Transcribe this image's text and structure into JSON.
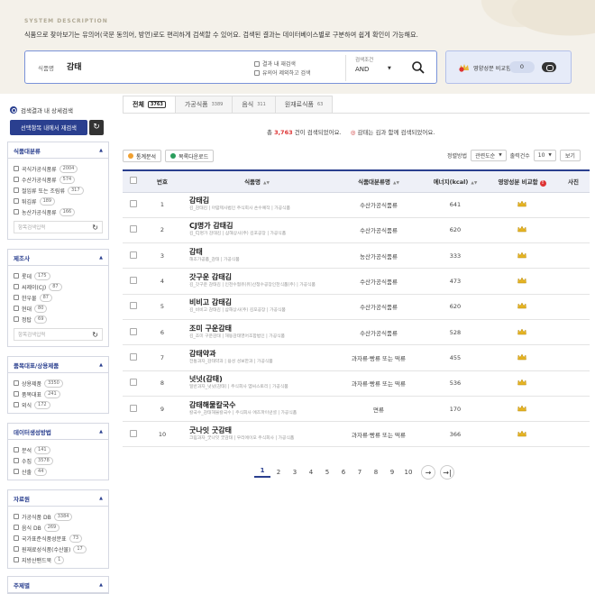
{
  "system": {
    "title": "SYSTEM DESCRIPTION",
    "text": "식품으로 찾아보기는 유의어(국문 동의어, 방언)로도 편리하게 검색할 수 있어요. 검색된 결과는 데이터베이스별로 구분하여 쉽게 확인이 가능해요."
  },
  "search": {
    "label": "식품명",
    "value": "감태",
    "option1": "결과 내 재검색",
    "option2": "유의어 제외하고 검색",
    "cond_title": "검색조건",
    "cond_value": "AND"
  },
  "compare": {
    "label": "영양성분 비교함",
    "count": "0"
  },
  "sidebar": {
    "title": "검색결과 내 상세검색",
    "apply_label": "선택항목 내에서 재검색",
    "search_placeholder": "항목검색입력",
    "facets": [
      {
        "title": "식품대분류",
        "items": [
          {
            "label": "곡식가공식품류",
            "count": "2004"
          },
          {
            "label": "수산가공식품류",
            "count": "574"
          },
          {
            "label": "절임류 또는 조림류",
            "count": "317"
          },
          {
            "label": "튀김류",
            "count": "189"
          },
          {
            "label": "농산가공식품류",
            "count": "166"
          }
        ]
      },
      {
        "title": "제조사",
        "items": [
          {
            "label": "롯데",
            "count": "175"
          },
          {
            "label": "씨제이(CJ)",
            "count": "87"
          },
          {
            "label": "한우물",
            "count": "87"
          },
          {
            "label": "현대",
            "count": "80"
          },
          {
            "label": "정탑",
            "count": "69"
          }
        ]
      },
      {
        "title": "품목대표/상용제품",
        "items": [
          {
            "label": "상용제품",
            "count": "3350"
          },
          {
            "label": "품목대표",
            "count": "241"
          },
          {
            "label": "외식",
            "count": "172"
          }
        ]
      },
      {
        "title": "데이터생성방법",
        "items": [
          {
            "label": "분석",
            "count": "141"
          },
          {
            "label": "수집",
            "count": "3578"
          },
          {
            "label": "산출",
            "count": "44"
          }
        ]
      },
      {
        "title": "자료원",
        "items": [
          {
            "label": "가공식품 DB",
            "count": "3384"
          },
          {
            "label": "음식 DB",
            "count": "269"
          },
          {
            "label": "국가표준식품성분표",
            "count": "73"
          },
          {
            "label": "원재료성식품(수산물)",
            "count": "17"
          },
          {
            "label": "지방산팬드북",
            "count": "1"
          }
        ]
      },
      {
        "title": "주제별",
        "items": []
      }
    ]
  },
  "tabs": [
    {
      "label": "전체",
      "count": "3763"
    },
    {
      "label": "가공식품",
      "count": "3389"
    },
    {
      "label": "음식",
      "count": "311"
    },
    {
      "label": "원재료식품",
      "count": "63"
    }
  ],
  "result": {
    "prefix": "총",
    "count": "3,763",
    "suffix": "건이 검색되었어요.",
    "related": "감태는 김과 함께 검색되었어요."
  },
  "tools": {
    "stats": "통계분석",
    "download": "목록다운로드",
    "sort_label": "정렬방법",
    "sort_value": "관련도순",
    "per_label": "출력건수",
    "per_value": "10",
    "view": "보기"
  },
  "table": {
    "headers": {
      "no": "번호",
      "name": "식품명",
      "category": "식품대분류명",
      "energy": "에너지(kcal)",
      "compare": "영양성분 비교함",
      "photo": "사진"
    },
    "rows": [
      {
        "no": "1",
        "name": "감태김",
        "sub": "김_감태김  |  아람제사법인 주식회사 손수예작  |  가공식품",
        "category": "수산가공식품류",
        "energy": "641"
      },
      {
        "no": "2",
        "name": "CJ명가 감태김",
        "sub": "김_CJ명가 감태김  |  삼해상사(주) 김포공장  |  가공식품",
        "category": "수산가공식품류",
        "energy": "620"
      },
      {
        "no": "3",
        "name": "감태",
        "sub": "해조가공품_감태  |  가공식품",
        "category": "농산가공식품류",
        "energy": "333"
      },
      {
        "no": "4",
        "name": "갓구운 감태김",
        "sub": "김_갓구운 감태김  |  인천수협유(유)산청수공장인천식품(주)  |  가공식품",
        "category": "수산가공식품류",
        "energy": "473"
      },
      {
        "no": "5",
        "name": "비비고 감태김",
        "sub": "김_비비고 감태김  |  삼해상사(주) 김포공장  |  가공식품",
        "category": "수산가공식품류",
        "energy": "620"
      },
      {
        "no": "6",
        "name": "조미 구운감태",
        "sub": "김_조미 구운감태  |  해동감태영어조합법인  |  가공식품",
        "category": "수산가공식품류",
        "energy": "528"
      },
      {
        "no": "7",
        "name": "감태약과",
        "sub": "전통과자_감태약과  |  용성 성보한과  |  가공식품",
        "category": "과자류·빵류 또는 떡류",
        "energy": "455"
      },
      {
        "no": "8",
        "name": "넛넛(감태)",
        "sub": "일반과자_넛넛(감태)  |  주식회사 엠씨스토리  |  가공식품",
        "category": "과자류·빵류 또는 떡류",
        "energy": "536"
      },
      {
        "no": "9",
        "name": "감태해물칼국수",
        "sub": "칼국수_감태해물칼국수  |  주식회사 에즈파이낸셜  |  가공식품",
        "category": "면류",
        "energy": "170"
      },
      {
        "no": "10",
        "name": "굿나잇 굿감태",
        "sub": "크림과자_굿나잇 굿감태  |  우리에이오 주식회사  |  가공식품",
        "category": "과자류·빵류 또는 떡류",
        "energy": "366"
      }
    ]
  },
  "pagination": {
    "pages": [
      "1",
      "2",
      "3",
      "4",
      "5",
      "6",
      "7",
      "8",
      "9",
      "10"
    ],
    "next": "→",
    "last": "→|"
  },
  "colors": {
    "primary": "#2a3f8f",
    "accent": "#d33333",
    "band": "#f4f1ea"
  }
}
